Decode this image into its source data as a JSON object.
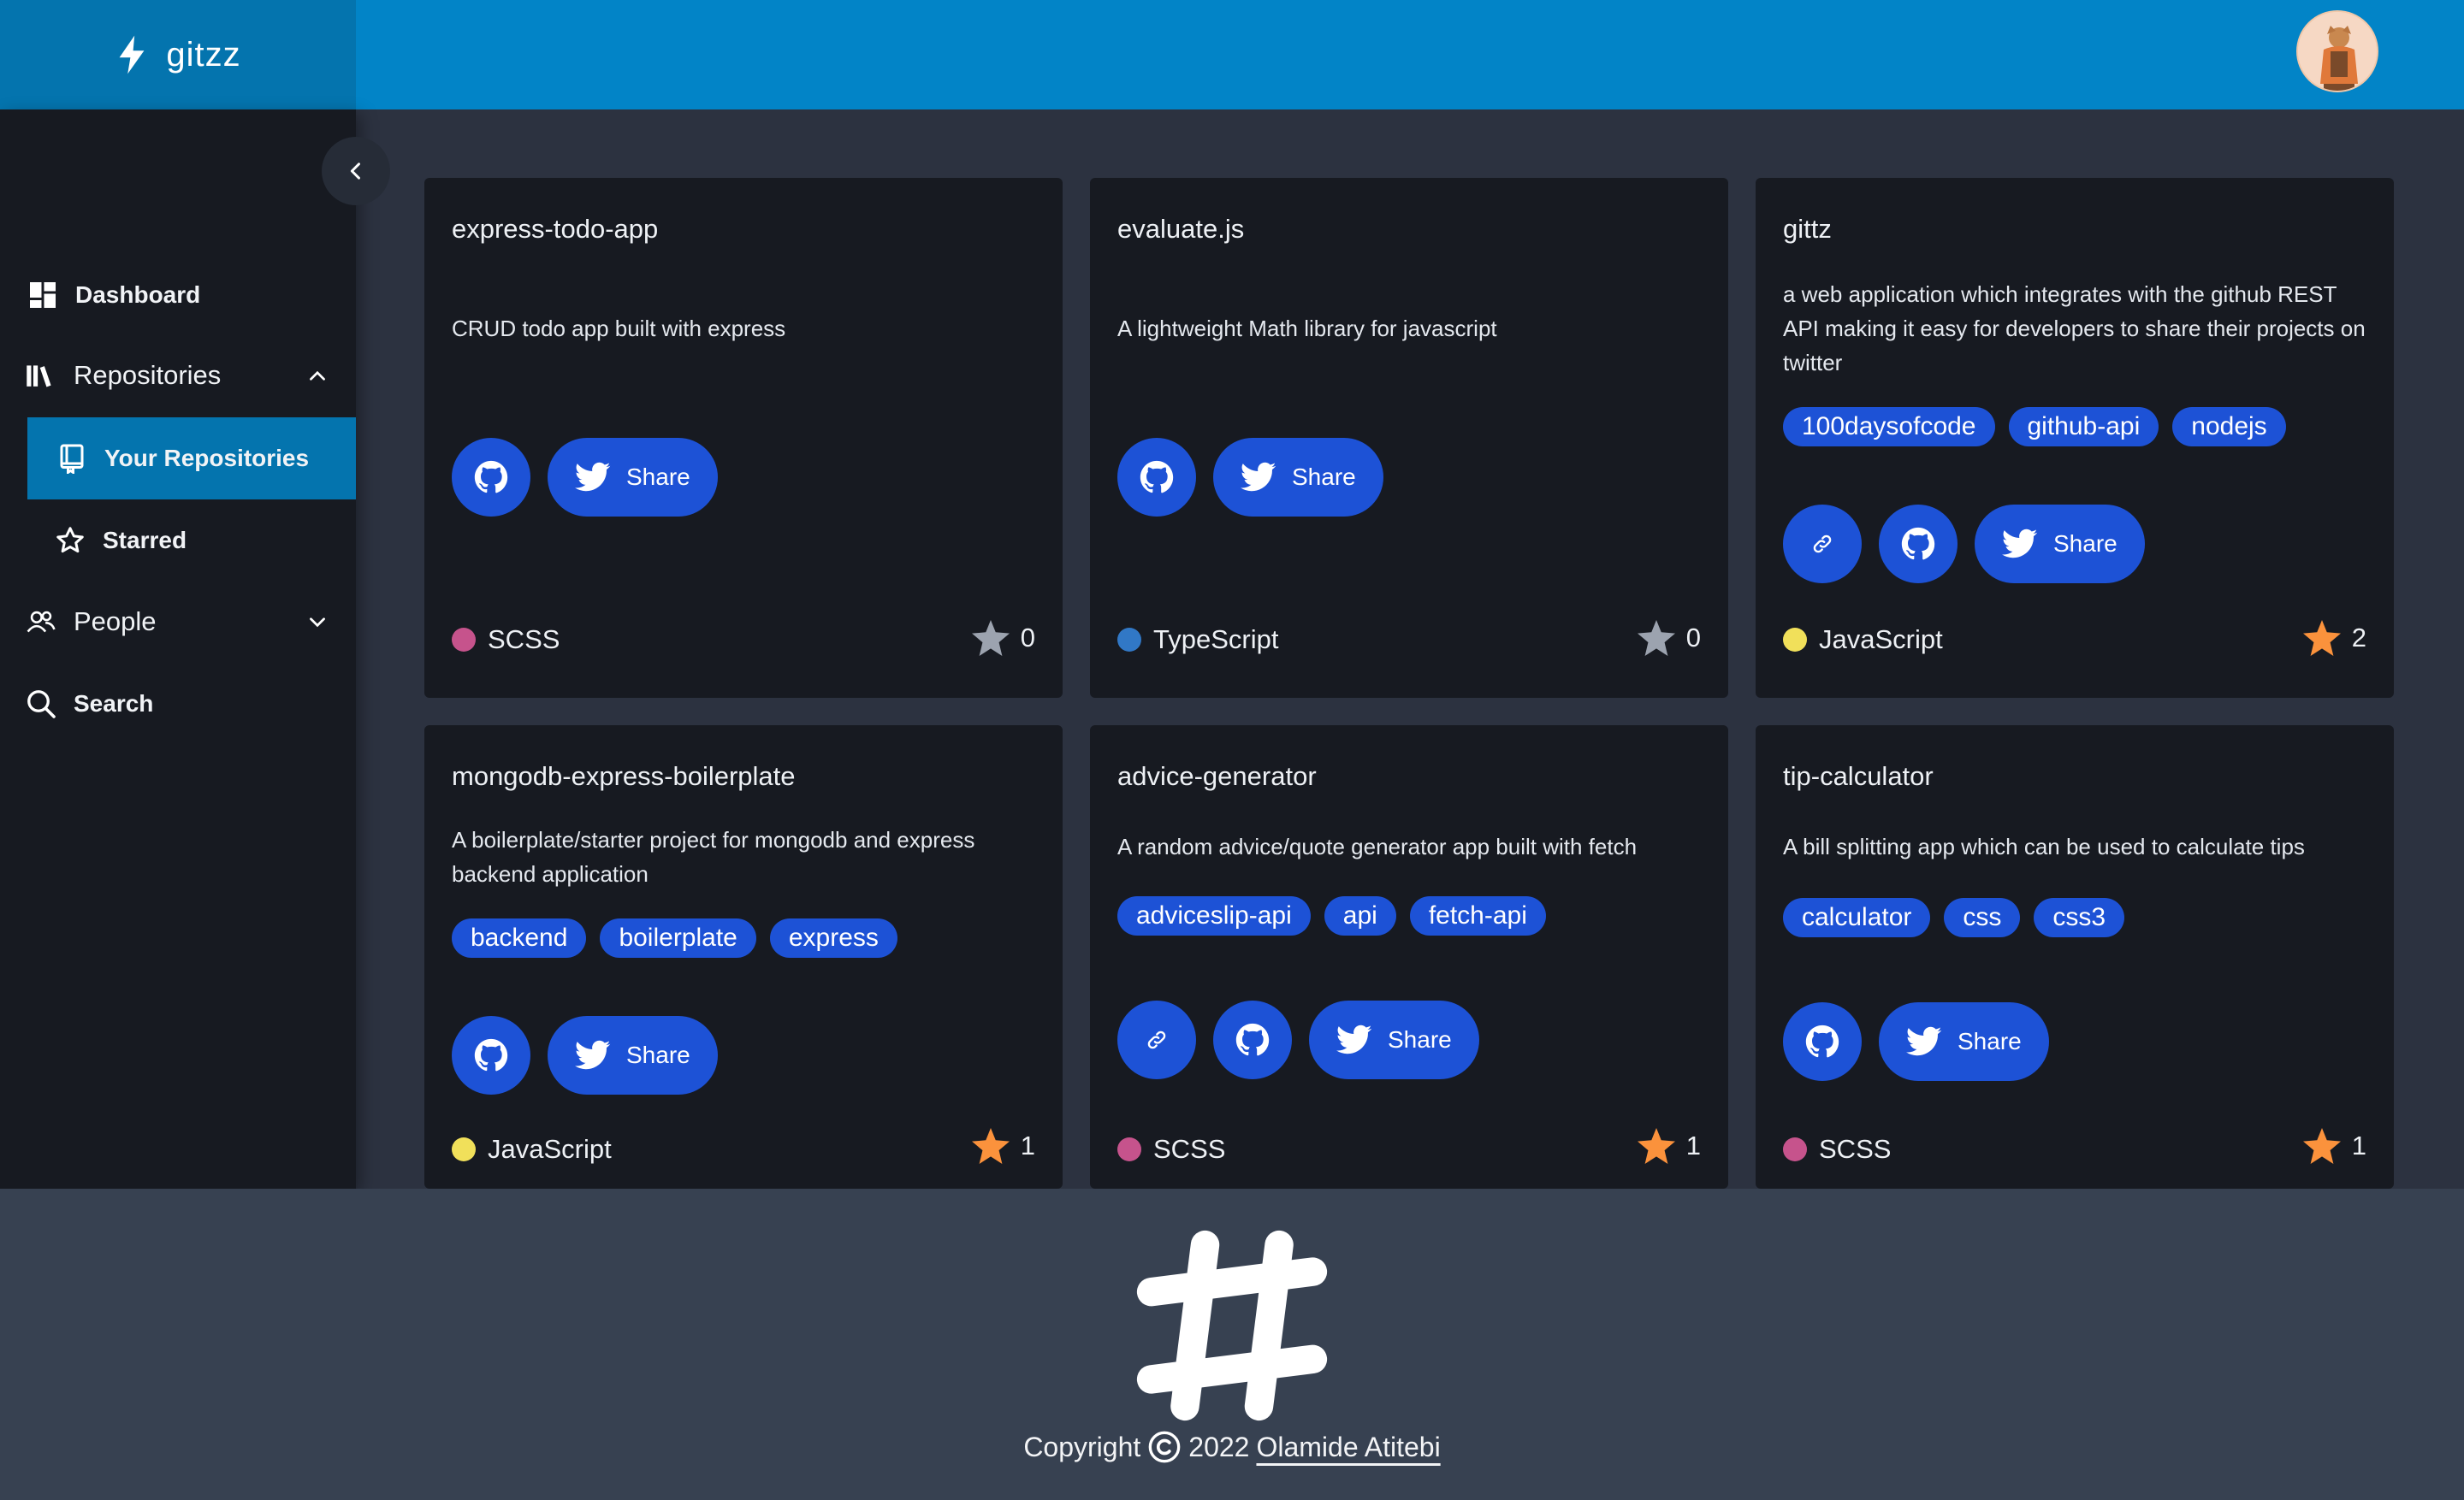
{
  "app": {
    "name": "gitzz"
  },
  "sidebar": {
    "items": [
      {
        "label": "Dashboard"
      },
      {
        "label": "Repositories"
      },
      {
        "label": "Your Repositories"
      },
      {
        "label": "Starred"
      },
      {
        "label": "People"
      },
      {
        "label": "Search"
      }
    ]
  },
  "repos": [
    {
      "name": "express-todo-app",
      "description": "CRUD todo app built with express",
      "tags": [],
      "share_label": "Share",
      "language": "SCSS",
      "language_color": "#c6538c",
      "stars": "0",
      "starred": false
    },
    {
      "name": "evaluate.js",
      "description": "A lightweight Math library for javascript",
      "tags": [],
      "share_label": "Share",
      "language": "TypeScript",
      "language_color": "#3178c6",
      "stars": "0",
      "starred": false
    },
    {
      "name": "gittz",
      "description": "a web application which integrates with the github REST API making it easy for developers to share their projects on twitter",
      "tags": [
        "100daysofcode",
        "github-api",
        "nodejs"
      ],
      "share_label": "Share",
      "language": "JavaScript",
      "language_color": "#f1e05a",
      "stars": "2",
      "starred": true
    },
    {
      "name": "mongodb-express-boilerplate",
      "description": "A boilerplate/starter project for mongodb and express backend application",
      "tags": [
        "backend",
        "boilerplate",
        "express"
      ],
      "share_label": "Share",
      "language": "JavaScript",
      "language_color": "#f1e05a",
      "stars": "1",
      "starred": true
    },
    {
      "name": "advice-generator",
      "description": "A random advice/quote generator app built with fetch",
      "tags": [
        "adviceslip-api",
        "api",
        "fetch-api"
      ],
      "share_label": "Share",
      "language": "SCSS",
      "language_color": "#c6538c",
      "stars": "1",
      "starred": true
    },
    {
      "name": "tip-calculator",
      "description": "A bill splitting app which can be used to calculate tips",
      "tags": [
        "calculator",
        "css",
        "css3"
      ],
      "share_label": "Share",
      "language": "SCSS",
      "language_color": "#c6538c",
      "stars": "1",
      "starred": true
    }
  ],
  "footer": {
    "copyright_prefix": "Copyright",
    "year": "2022",
    "author": "Olamide Atitebi"
  },
  "colors": {
    "header": "#0284c7",
    "brand_bg": "#0474ae",
    "accent_button": "#1d52d6",
    "star_active": "#fb923c",
    "star_inactive": "#9ca3af"
  },
  "icons": {
    "brand": "lightning-bolt-icon",
    "collapse": "chevron-left-icon",
    "dashboard": "dashboard-grid-icon",
    "repositories": "books-icon",
    "your_repositories": "repo-book-icon",
    "starred": "star-outline-icon",
    "people": "people-icon",
    "search": "search-icon",
    "github": "github-icon",
    "link": "link-icon",
    "twitter": "twitter-icon",
    "star": "star-icon",
    "footer_logo": "hash-logo-icon",
    "copyright": "copyright-icon"
  }
}
